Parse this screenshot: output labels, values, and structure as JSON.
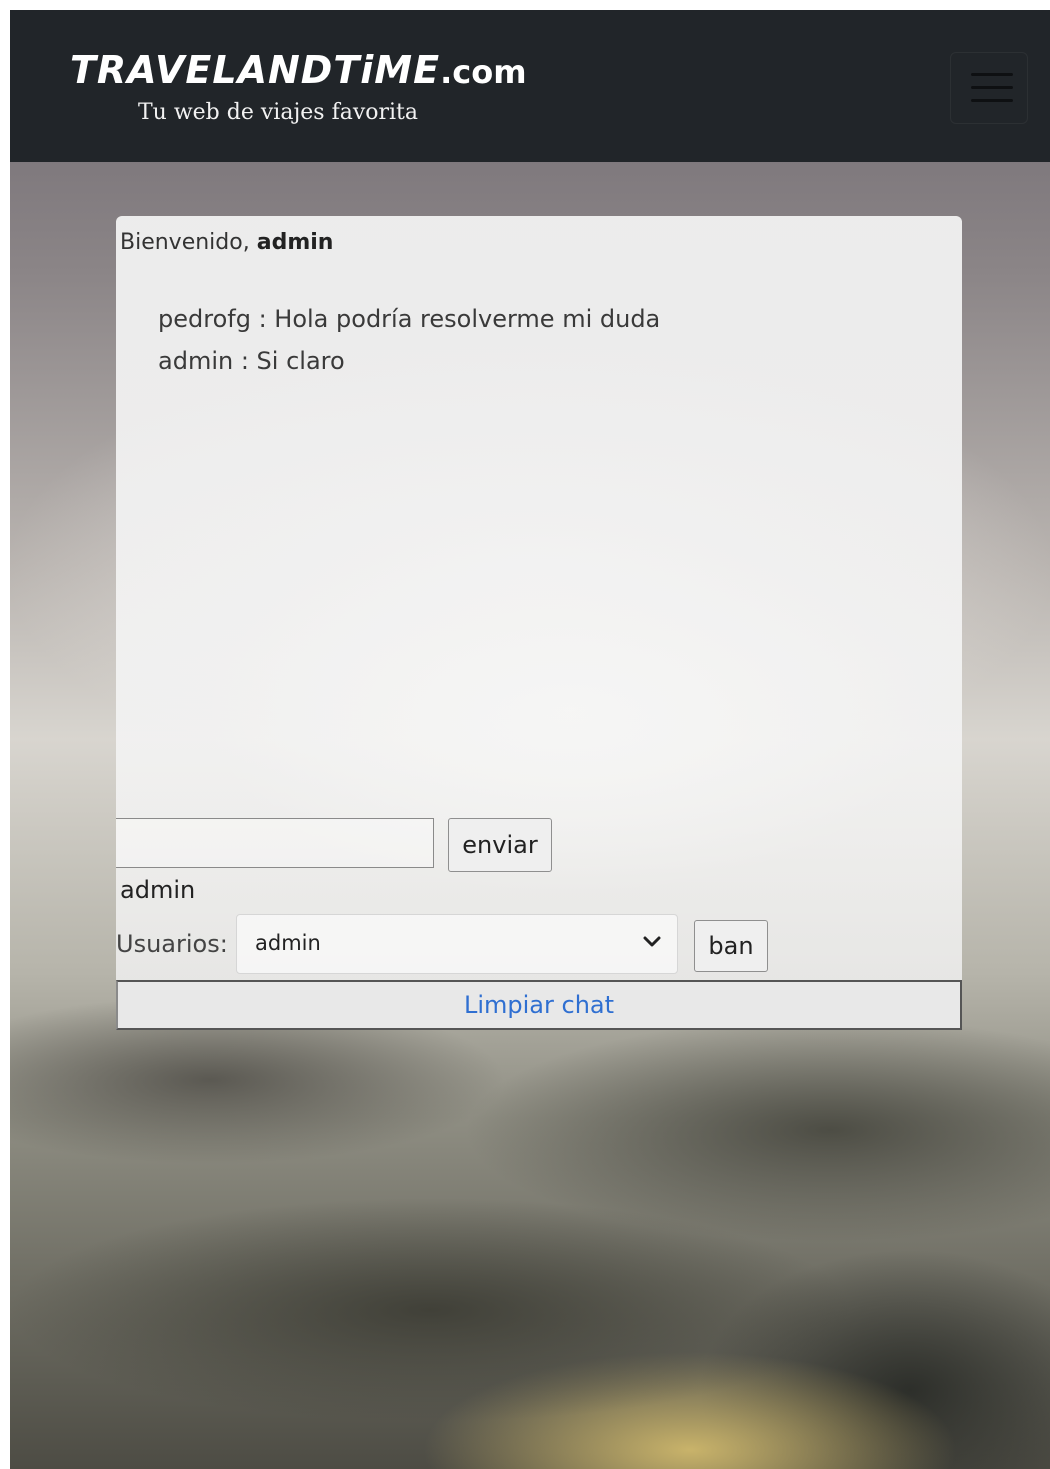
{
  "header": {
    "brand_name": "TRAVELANDTiME",
    "brand_suffix": ".com",
    "tagline": "Tu web de viajes favorita"
  },
  "chat": {
    "welcome_prefix": "Bienvenido,",
    "welcome_user": "admin",
    "messages": [
      {
        "text": "pedrofg : Hola podría resolverme mi duda"
      },
      {
        "text": "admin : Si claro"
      }
    ],
    "input_value": "",
    "send_label": "enviar",
    "current_user": "admin",
    "users_label": "Usuarios:",
    "selected_user": "admin",
    "ban_label": "ban",
    "clear_label": "Limpiar chat"
  },
  "colors": {
    "navbar": "#212529",
    "link_blue": "#2f6fd1"
  }
}
